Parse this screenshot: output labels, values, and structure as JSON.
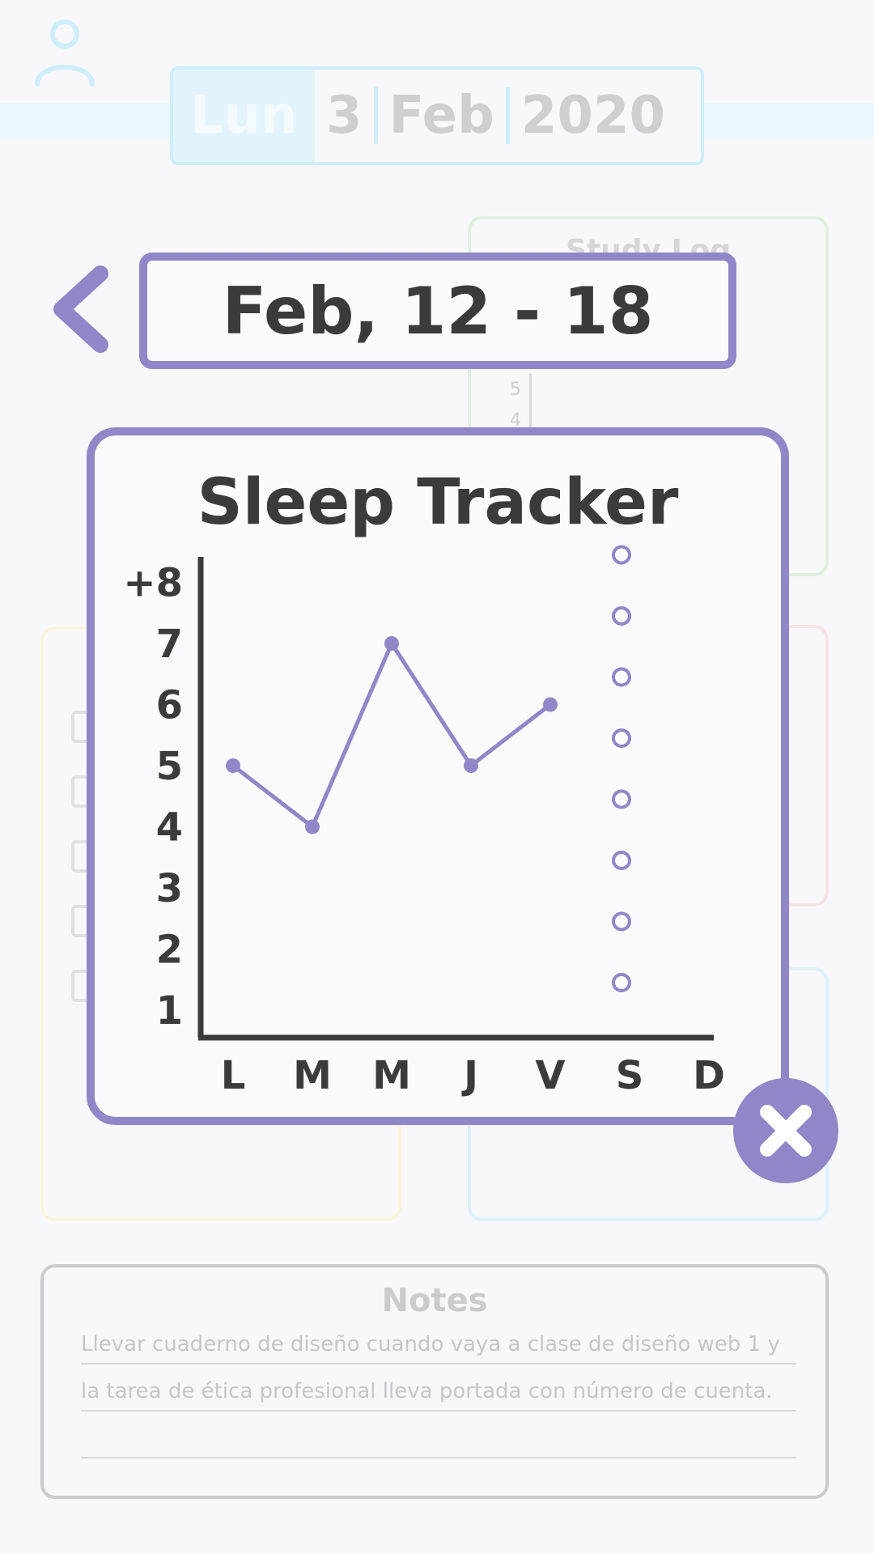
{
  "header": {
    "day": "Lun",
    "date_day": "3",
    "date_month": "Feb",
    "date_year": "2020"
  },
  "study_log": {
    "title": "Study Log",
    "ticks": [
      "5",
      "4"
    ]
  },
  "week": {
    "range": "Feb, 12 - 18"
  },
  "modal": {
    "title": "Sleep Tracker"
  },
  "chart_data": {
    "type": "line",
    "categories": [
      "L",
      "M",
      "M",
      "J",
      "V",
      "S",
      "D"
    ],
    "y_tick_labels": [
      "+8",
      "7",
      "6",
      "5",
      "4",
      "3",
      "2",
      "1"
    ],
    "ylim": [
      1,
      8
    ],
    "series": [
      {
        "values": [
          5,
          4,
          7,
          5,
          6,
          null,
          null
        ]
      }
    ],
    "option_dots_column": "S",
    "option_dots_values": [
      8,
      7,
      6,
      5,
      4,
      3,
      2,
      1
    ],
    "colors": {
      "line": "#8f87c7",
      "axis": "#3b3b3d"
    }
  },
  "notes": {
    "title": "Notes",
    "lines": [
      "Llevar cuaderno de diseño cuando vaya a clase de diseño web 1 y",
      "la tarea de ética profesional lleva portada con número de cuenta.",
      ""
    ]
  },
  "icons": {
    "profile": "profile-icon",
    "back": "chevron-left-icon",
    "close": "close-icon"
  },
  "colors": {
    "accent": "#8f87c7",
    "text": "#3b3b3d",
    "background": "#f8f8fc"
  }
}
